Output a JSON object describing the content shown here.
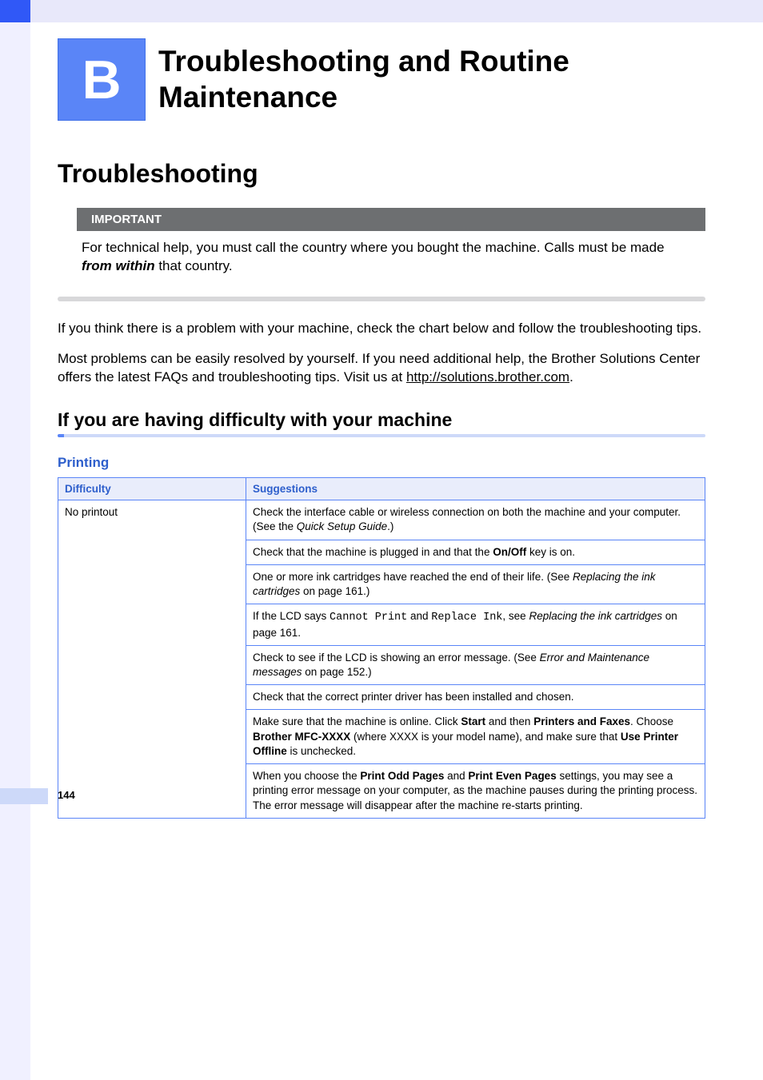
{
  "chapter": {
    "letter": "B",
    "title": "Troubleshooting and Routine Maintenance"
  },
  "h1": "Troubleshooting",
  "important": {
    "label": "IMPORTANT",
    "text_pre": "For technical help, you must call the country where you bought the machine. Calls must be made ",
    "text_bold_italic": "from within",
    "text_post": " that country."
  },
  "para1": "If you think there is a problem with your machine, check the chart below and follow the troubleshooting tips.",
  "para2_pre": "Most problems can be easily resolved by yourself. If you need additional help, the Brother Solutions Center offers the latest FAQs and troubleshooting tips. Visit us at ",
  "para2_link": "http://solutions.brother.com",
  "para2_post": ".",
  "h2": "If you are having difficulty with your machine",
  "h3": "Printing",
  "table": {
    "headers": {
      "col1": "Difficulty",
      "col2": "Suggestions"
    },
    "difficulty": "No printout",
    "rows": [
      {
        "plain_pre": "Check the interface cable or wireless connection on both the machine and your computer. (See the ",
        "italic1": "Quick Setup Guide",
        "plain_post": ".)"
      },
      {
        "plain_pre": "Check that the machine is plugged in and that the ",
        "bold1": "On/Off",
        "plain_post": " key is on."
      },
      {
        "plain_pre": "One or more ink cartridges have reached the end of their life. (See ",
        "italic1": "Replacing the ink cartridges",
        "plain_post": " on page 161.)"
      },
      {
        "plain_pre": "If the LCD says ",
        "mono1": "Cannot Print",
        "mid1": " and ",
        "mono2": "Replace Ink",
        "mid2": ", see ",
        "italic1": "Replacing the ink cartridges",
        "plain_post": " on page 161."
      },
      {
        "plain_pre": "Check to see if the LCD is showing an error message. (See ",
        "italic1": "Error and Maintenance messages",
        "plain_post": " on page 152.)"
      },
      {
        "plain_pre": "Check that the correct printer driver has been installed and chosen."
      },
      {
        "plain_pre": "Make sure that the machine is online. Click ",
        "bold1": "Start",
        "mid1": " and then ",
        "bold2": "Printers and Faxes",
        "mid2": ". Choose ",
        "bold3": "Brother MFC-XXXX",
        "mid3": " (where XXXX is your model name), and make sure that ",
        "bold4": "Use Printer Offline",
        "plain_post": " is unchecked."
      },
      {
        "plain_pre": "When you choose the ",
        "bold1": "Print Odd Pages",
        "mid1": " and ",
        "bold2": "Print Even Pages",
        "plain_post": " settings, you may see a printing error message on your computer, as the machine pauses during the printing process. The error message will disappear after the machine re-starts printing."
      }
    ]
  },
  "page_number": "144"
}
